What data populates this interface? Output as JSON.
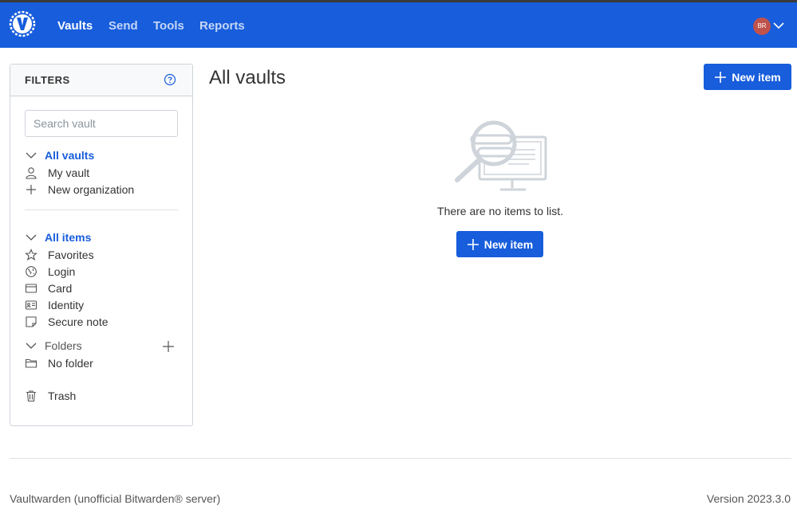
{
  "navbar": {
    "links": [
      "Vaults",
      "Send",
      "Tools",
      "Reports"
    ],
    "avatar_initials": "BR",
    "brand_color": "#175ddc"
  },
  "filters": {
    "title": "FILTERS",
    "search_placeholder": "Search vault",
    "vaults_heading": "All vaults",
    "vault_items": [
      "My vault",
      "New organization"
    ],
    "items_heading": "All items",
    "type_items": [
      "Favorites",
      "Login",
      "Card",
      "Identity",
      "Secure note"
    ],
    "folders_heading": "Folders",
    "folder_items": [
      "No folder"
    ],
    "trash_label": "Trash"
  },
  "main": {
    "title": "All vaults",
    "new_item_label": "New item",
    "empty_text": "There are no items to list.",
    "empty_new_item_label": "New item"
  },
  "footer": {
    "left": "Vaultwarden (unofficial Bitwarden® server)",
    "right": "Version 2023.3.0"
  }
}
